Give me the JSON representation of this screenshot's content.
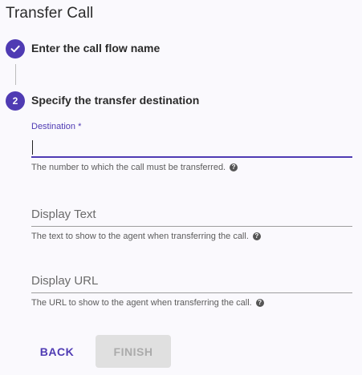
{
  "page": {
    "title": "Transfer Call"
  },
  "steps": [
    {
      "number": "1",
      "label": "Enter the call flow name",
      "status": "completed",
      "icon": "check-icon"
    },
    {
      "number": "2",
      "label": "Specify the transfer destination",
      "status": "active"
    }
  ],
  "form": {
    "destination": {
      "label": "Destination *",
      "value": "",
      "helper": "The number to which the call must be transferred."
    },
    "display_text": {
      "label": "Display Text",
      "value": "",
      "helper": "The text to show to the agent when transferring the call."
    },
    "display_url": {
      "label": "Display URL",
      "value": "",
      "helper": "The URL to show to the agent when transferring the call."
    }
  },
  "actions": {
    "back_label": "BACK",
    "finish_label": "FINISH"
  },
  "colors": {
    "accent": "#4f3bb3",
    "background": "#faf9fd",
    "disabled_bg": "#e0e0e0",
    "disabled_text": "#ababab"
  }
}
